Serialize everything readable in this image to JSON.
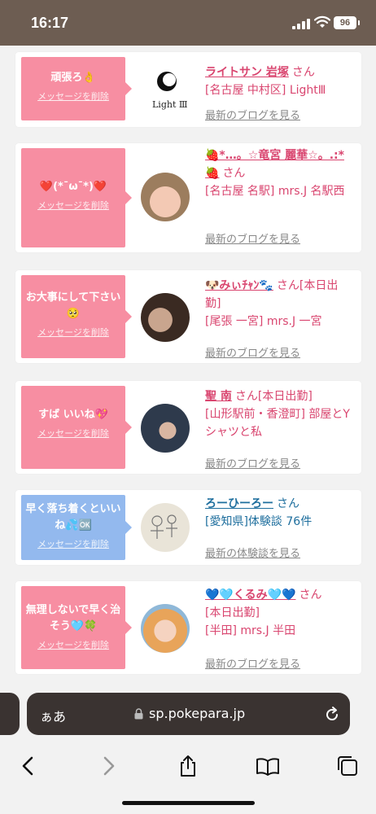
{
  "status": {
    "time": "16:17",
    "battery": "96"
  },
  "browser": {
    "aa": "ぁあ",
    "url": "sp.pokepara.jp"
  },
  "delete_label": "メッセージを削除",
  "blog_link": "最新のブログを見る",
  "review_link": "最新の体験談を見る",
  "cards": [
    {
      "message": "頑張ろ👌",
      "name": "ライトサン 岩塚",
      "san": "さん",
      "line1": "[名古屋 中村区] LightⅢ",
      "line2": "",
      "logo": "Light Ⅲ"
    },
    {
      "message": "❤️(*¯ω¯*)❤️",
      "name": "🍓*…。☆竜宮 麗華☆。.:*🍓",
      "san": "さん",
      "line1": "[名古屋 名駅] mrs.J 名駅西",
      "line2": ""
    },
    {
      "message": "お大事にして下さい🥺",
      "name": "🐶みぃﾁｬﾝ🐾",
      "san": "さん[本日出勤]",
      "line1": "[尾張 一宮] mrs.J 一宮",
      "line2": ""
    },
    {
      "message": "すば いいね💖",
      "name": "聖 南",
      "san": "さん[本日出勤]",
      "line1": "[山形駅前・香澄町] 部屋とYシャツと私",
      "line2": ""
    },
    {
      "message": "早く落ち着くといいね💦🆗",
      "name": "ろーひーろー",
      "san": "さん",
      "line1": "[愛知県]体験談 76件",
      "line2": ""
    },
    {
      "message": "無理しないで早く治そう🩵🍀",
      "name": "💙🩵くるみ🩵💙",
      "san": "さん",
      "line1": "[本日出勤]",
      "line2": "[半田] mrs.J 半田"
    }
  ]
}
